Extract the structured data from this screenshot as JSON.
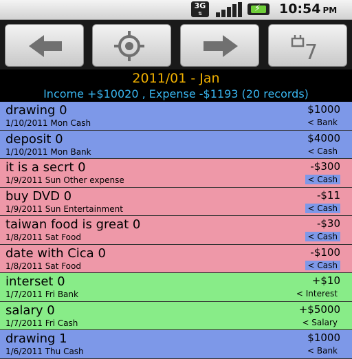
{
  "status_bar": {
    "network": "3G",
    "time": "10:54",
    "ampm": "PM",
    "battery_color": "#6fce3a"
  },
  "toolbar": {
    "buttons": [
      {
        "name": "back-arrow-icon"
      },
      {
        "name": "target-icon"
      },
      {
        "name": "forward-arrow-icon"
      },
      {
        "name": "calendar-icon",
        "label": "7"
      }
    ]
  },
  "header": {
    "month": "2011/01 - Jan",
    "summary": "Income +$10020 , Expense -$1193 (20 records)"
  },
  "colors": {
    "month": "#f0b000",
    "summary": "#39b6f0",
    "transfer": "#7d98e8",
    "expense": "#ee98a8",
    "income": "#88ec88"
  },
  "records": [
    {
      "type": "transfer",
      "name": "drawing  0",
      "amount": "$1000",
      "meta": "1/10/2011 Mon Cash",
      "category": "< Bank"
    },
    {
      "type": "transfer",
      "name": "deposit  0",
      "amount": "$4000",
      "meta": "1/10/2011 Mon Bank",
      "category": "< Cash"
    },
    {
      "type": "expense",
      "name": "it is a secrt  0",
      "amount": "-$300",
      "meta": "1/9/2011 Sun Other expense",
      "category": "< Cash"
    },
    {
      "type": "expense",
      "name": "buy DVD 0",
      "amount": "-$11",
      "meta": "1/9/2011 Sun Entertainment",
      "category": "< Cash"
    },
    {
      "type": "expense",
      "name": "taiwan food is great 0",
      "amount": "-$30",
      "meta": "1/8/2011 Sat Food",
      "category": "< Cash"
    },
    {
      "type": "expense",
      "name": "date with Cica 0",
      "amount": "-$100",
      "meta": "1/8/2011 Sat Food",
      "category": "< Cash"
    },
    {
      "type": "income",
      "name": "interset 0",
      "amount": "+$10",
      "meta": "1/7/2011 Fri Bank",
      "category": "< Interest"
    },
    {
      "type": "income",
      "name": "salary 0",
      "amount": "+$5000",
      "meta": "1/7/2011 Fri Cash",
      "category": "< Salary"
    },
    {
      "type": "transfer",
      "name": "drawing  1",
      "amount": "$1000",
      "meta": "1/6/2011 Thu Cash",
      "category": "< Bank"
    }
  ]
}
